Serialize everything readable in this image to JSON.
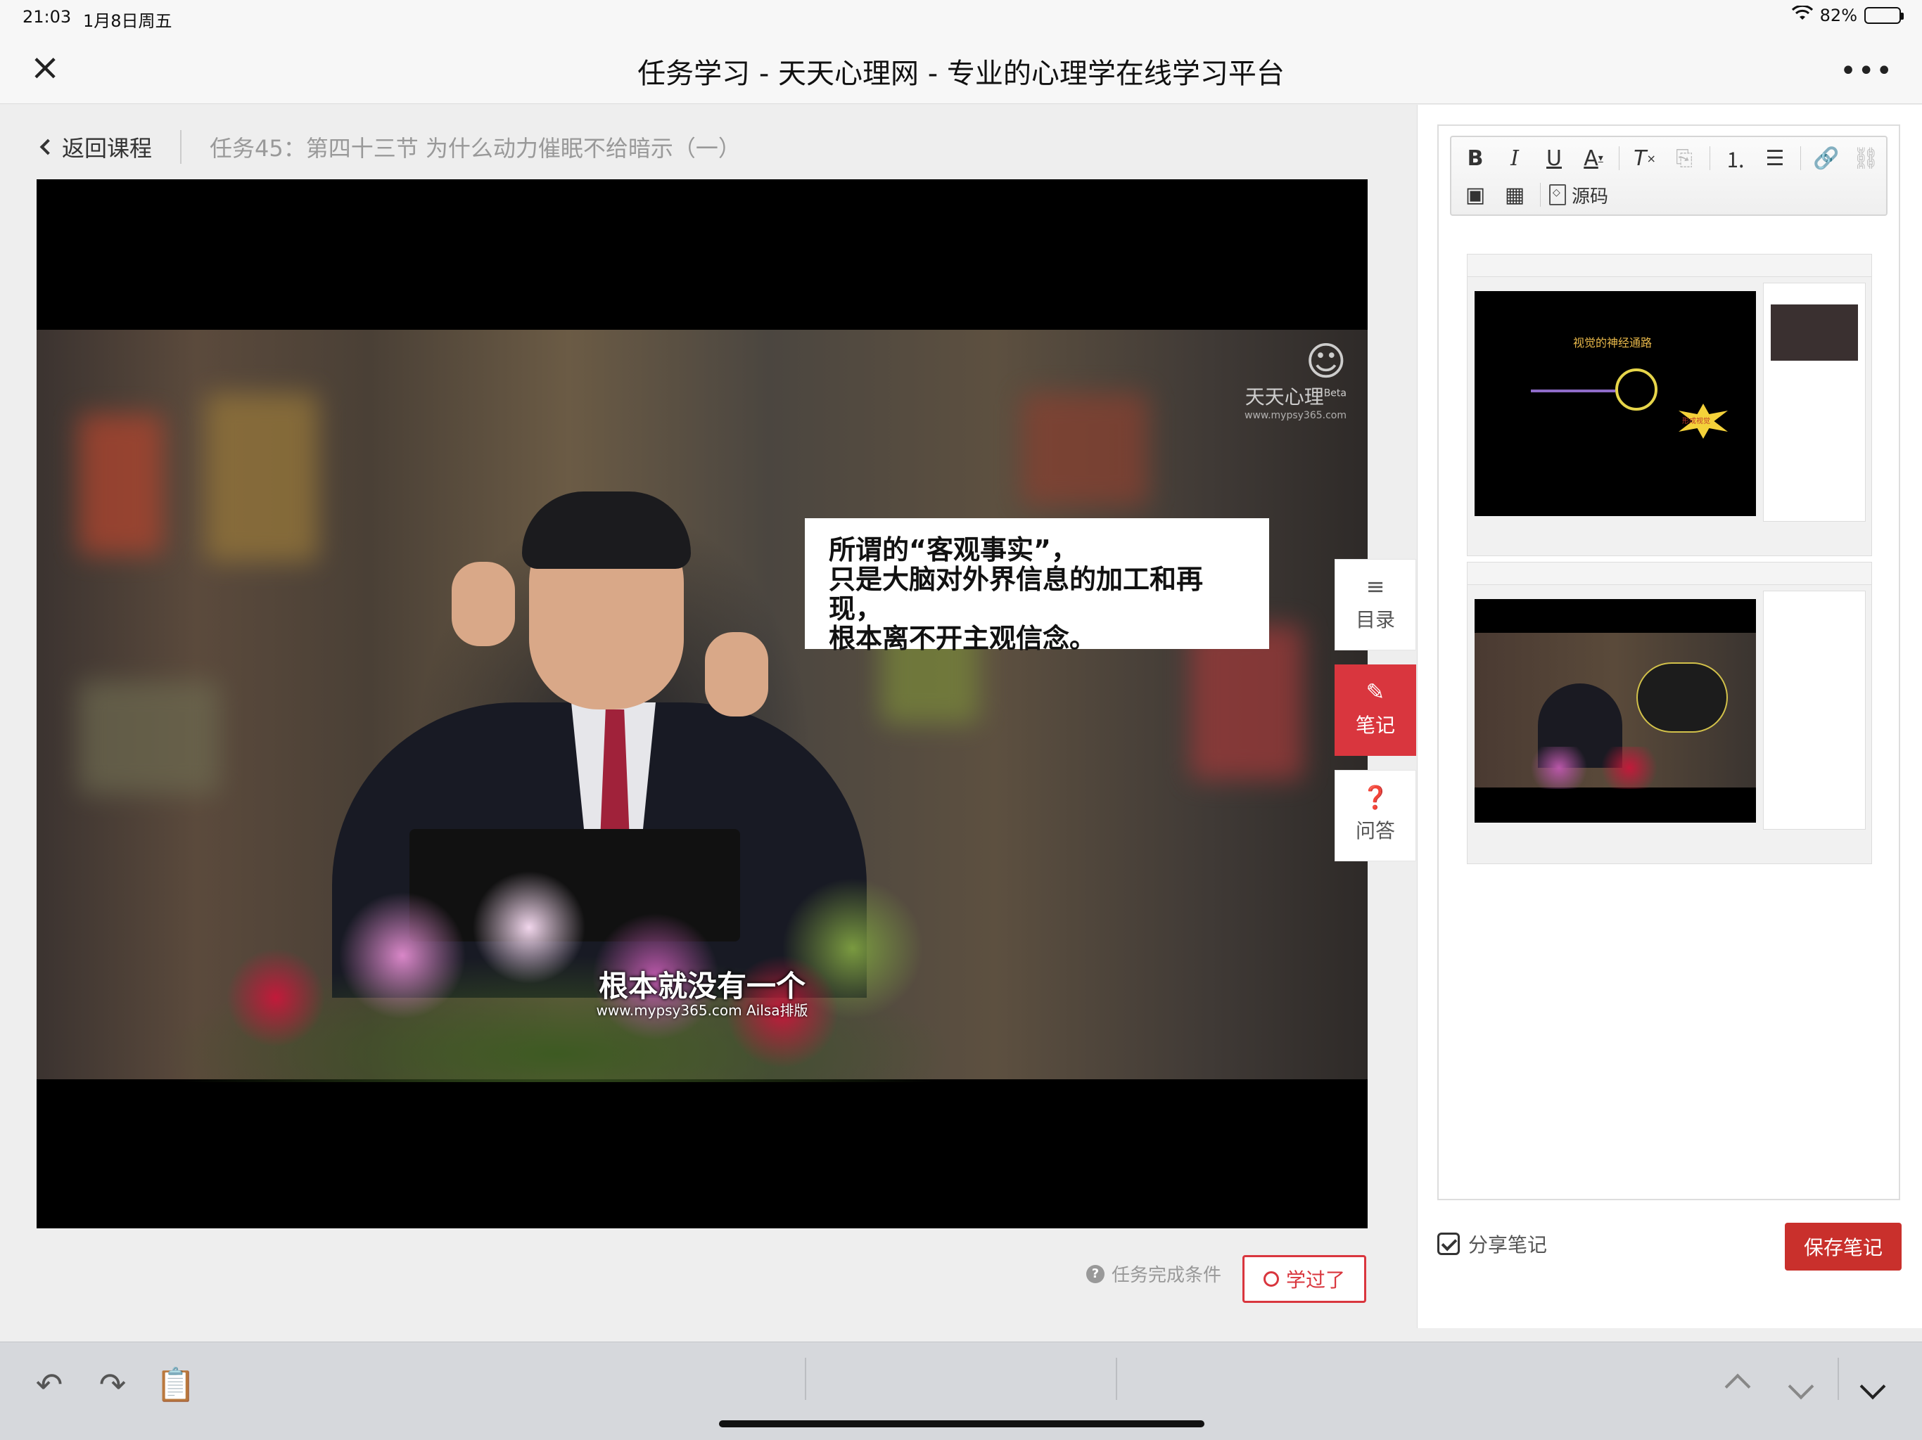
{
  "status": {
    "time": "21:03",
    "date": "1月8日周五",
    "battery": "82%",
    "battery_level": 0.82
  },
  "window": {
    "title": "任务学习 - 天天心理网 - 专业的心理学在线学习平台"
  },
  "breadcrumb": {
    "back_label": "返回课程",
    "task_title": "任务45：第四十三节 为什么动力催眠不给暗示（一）"
  },
  "video": {
    "logo_text": "天天心理",
    "logo_badge": "Beta",
    "logo_url": "www.mypsy365.com",
    "caption_lines": [
      "所谓的“客观事实”，",
      "只是大脑对外界信息的加工和再现，",
      "根本离不开主观信念。"
    ],
    "subtitle": "根本就没有一个",
    "subtitle_credit": "www.mypsy365.com Ailsa排版"
  },
  "side_tabs": [
    {
      "label": "目录",
      "icon": "menu-icon",
      "active": false
    },
    {
      "label": "笔记",
      "icon": "pencil-icon",
      "active": true
    },
    {
      "label": "问答",
      "icon": "question-icon",
      "active": false
    }
  ],
  "actions": {
    "task_condition": "任务完成条件",
    "learned": "学过了"
  },
  "notes": {
    "toolbar_source_label": "源码",
    "share_label": "分享笔记",
    "share_checked": true,
    "save_label": "保存笔记",
    "embedded": {
      "thumb1_slide_title": "视觉的神经通路",
      "thumb1_burst": "形成视觉"
    }
  },
  "colors": {
    "accent": "#d9363e",
    "save_bg": "#c9302c"
  }
}
